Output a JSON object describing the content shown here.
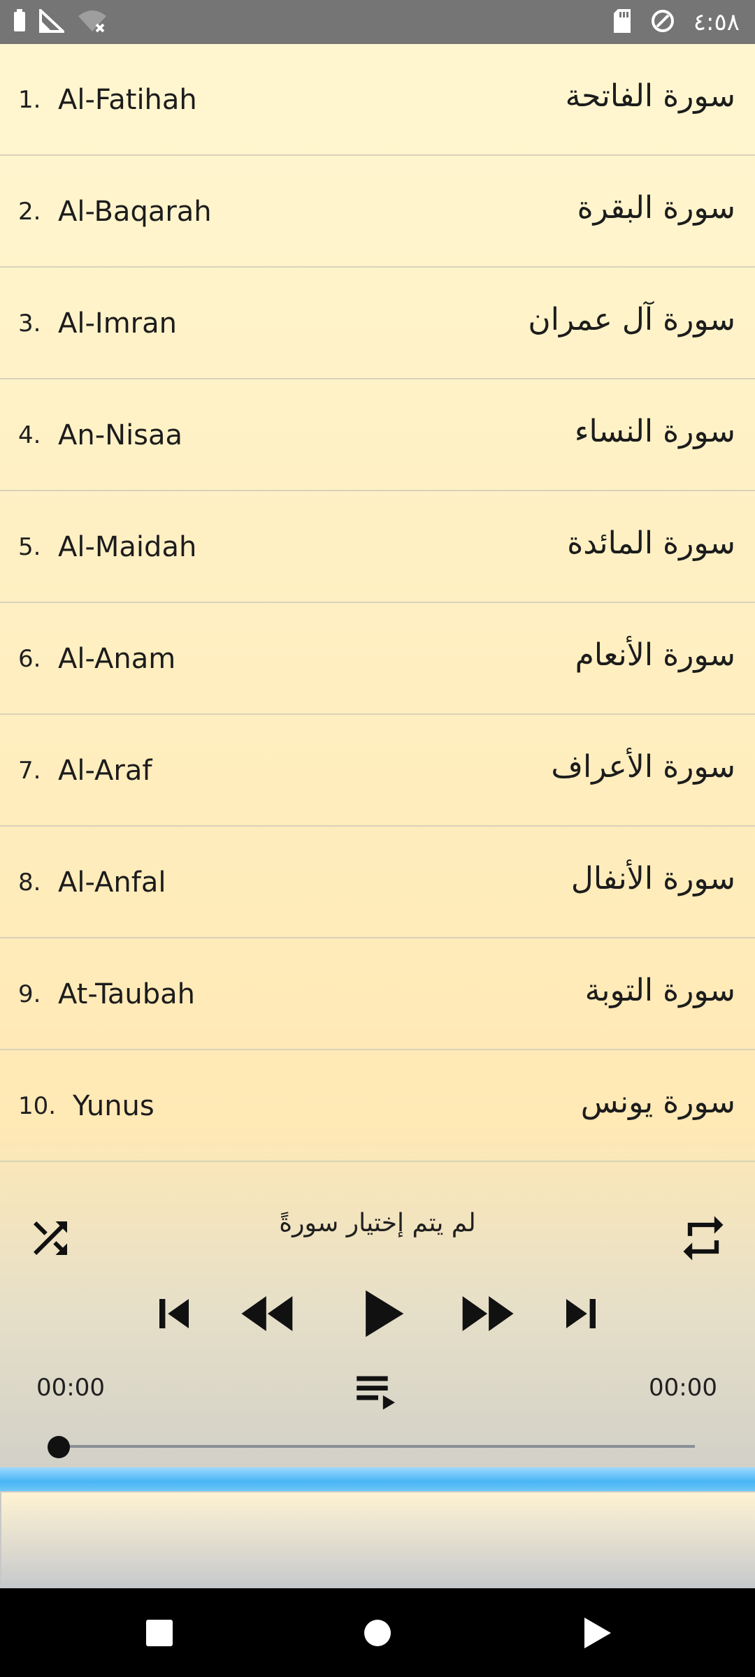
{
  "status_bar": {
    "time": "٤:٥٨"
  },
  "surahs": [
    {
      "number": "1.",
      "english": "Al-Fatihah",
      "arabic": "سورة الفاتحة"
    },
    {
      "number": "2.",
      "english": "Al-Baqarah",
      "arabic": "سورة البقرة"
    },
    {
      "number": "3.",
      "english": "Al-Imran",
      "arabic": "سورة آل عمران"
    },
    {
      "number": "4.",
      "english": "An-Nisaa",
      "arabic": "سورة النساء"
    },
    {
      "number": "5.",
      "english": "Al-Maidah",
      "arabic": "سورة المائدة"
    },
    {
      "number": "6.",
      "english": "Al-Anam",
      "arabic": "سورة الأنعام"
    },
    {
      "number": "7.",
      "english": "Al-Araf",
      "arabic": "سورة الأعراف"
    },
    {
      "number": "8.",
      "english": "Al-Anfal",
      "arabic": "سورة الأنفال"
    },
    {
      "number": "9.",
      "english": "At-Taubah",
      "arabic": "سورة التوبة"
    },
    {
      "number": "10.",
      "english": "Yunus",
      "arabic": "سورة يونس"
    }
  ],
  "player": {
    "now_playing": "لم يتم إختيار سورةً",
    "elapsed": "00:00",
    "duration": "00:00",
    "progress": 0
  },
  "icons": {
    "shuffle": "shuffle-icon",
    "repeat": "repeat-icon",
    "skip_previous": "skip-previous-icon",
    "rewind": "rewind-icon",
    "play": "play-icon",
    "fast_forward": "fast-forward-icon",
    "skip_next": "skip-next-icon",
    "playlist": "playlist-icon"
  }
}
